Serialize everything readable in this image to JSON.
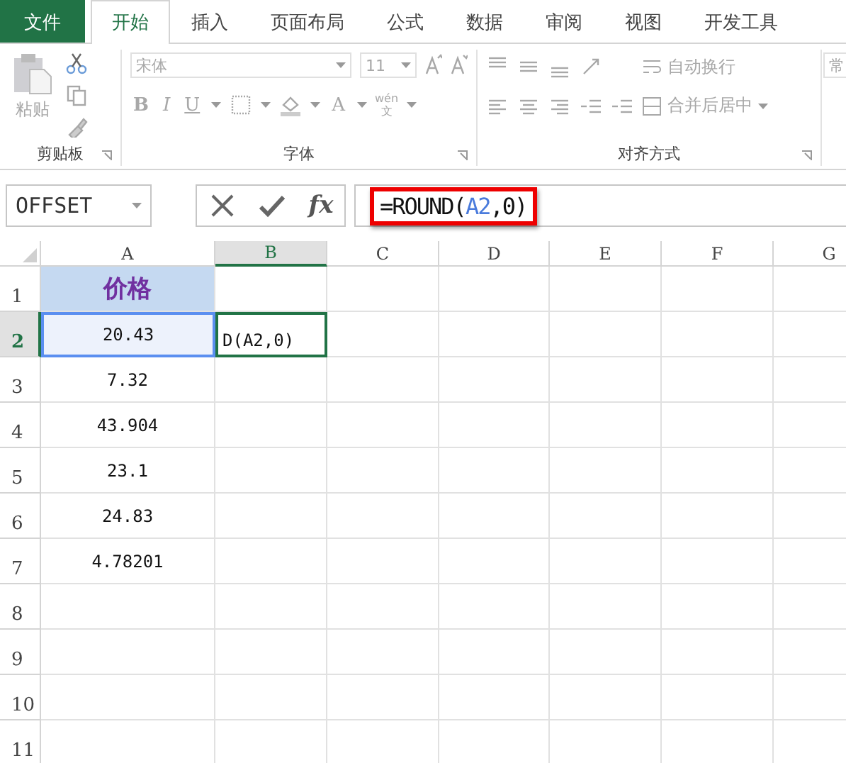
{
  "tabs": [
    {
      "label": "文件",
      "kind": "file",
      "selected": false
    },
    {
      "label": "开始",
      "kind": "tab",
      "selected": true
    },
    {
      "label": "插入",
      "kind": "tab",
      "selected": false
    },
    {
      "label": "页面布局",
      "kind": "tab",
      "selected": false
    },
    {
      "label": "公式",
      "kind": "tab",
      "selected": false
    },
    {
      "label": "数据",
      "kind": "tab",
      "selected": false
    },
    {
      "label": "审阅",
      "kind": "tab",
      "selected": false
    },
    {
      "label": "视图",
      "kind": "tab",
      "selected": false
    },
    {
      "label": "开发工具",
      "kind": "tab",
      "selected": false
    }
  ],
  "ribbon": {
    "disabled": true,
    "clipboard": {
      "paste": "粘贴",
      "label": "剪贴板"
    },
    "font": {
      "font_name": "宋体",
      "font_size": "11",
      "bold": "B",
      "italic": "I",
      "underline": "U",
      "font_color": "A",
      "phonetic_top": "wén",
      "phonetic_bottom": "文",
      "label": "字体"
    },
    "alignment": {
      "wrap_text": "自动换行",
      "merge_center": "合并后居中",
      "label": "对齐方式"
    },
    "number": {
      "format": "常"
    }
  },
  "name_box": "OFFSET",
  "function_button": "fx",
  "formula": [
    {
      "text": "=ROUND(",
      "kind": "plain"
    },
    {
      "text": "A2",
      "kind": "ref"
    },
    {
      "text": ",0)",
      "kind": "plain"
    }
  ],
  "formula_highlighted": true,
  "columns": [
    {
      "label": "A",
      "selected": false
    },
    {
      "label": "B",
      "selected": true
    },
    {
      "label": "C",
      "selected": false
    },
    {
      "label": "D",
      "selected": false
    },
    {
      "label": "E",
      "selected": false
    },
    {
      "label": "F",
      "selected": false
    },
    {
      "label": "G",
      "selected": false
    }
  ],
  "rows": [
    {
      "label": "1",
      "selected": false,
      "cells": [
        {
          "text": "价格",
          "kind": "title"
        }
      ]
    },
    {
      "label": "2",
      "selected": true,
      "cells": [
        {
          "text": "20.43",
          "kind": "referenced"
        },
        {
          "text": "D(A2,0)",
          "kind": "editing"
        }
      ]
    },
    {
      "label": "3",
      "selected": false,
      "cells": [
        {
          "text": "7.32",
          "kind": "value"
        }
      ]
    },
    {
      "label": "4",
      "selected": false,
      "cells": [
        {
          "text": "43.904",
          "kind": "value"
        }
      ]
    },
    {
      "label": "5",
      "selected": false,
      "cells": [
        {
          "text": "23.1",
          "kind": "value"
        }
      ]
    },
    {
      "label": "6",
      "selected": false,
      "cells": [
        {
          "text": "24.83",
          "kind": "value"
        }
      ]
    },
    {
      "label": "7",
      "selected": false,
      "cells": [
        {
          "text": "4.78201",
          "kind": "value"
        }
      ]
    },
    {
      "label": "8",
      "selected": false
    },
    {
      "label": "9",
      "selected": false
    },
    {
      "label": "10",
      "selected": false
    },
    {
      "label": "11",
      "selected": false
    }
  ]
}
